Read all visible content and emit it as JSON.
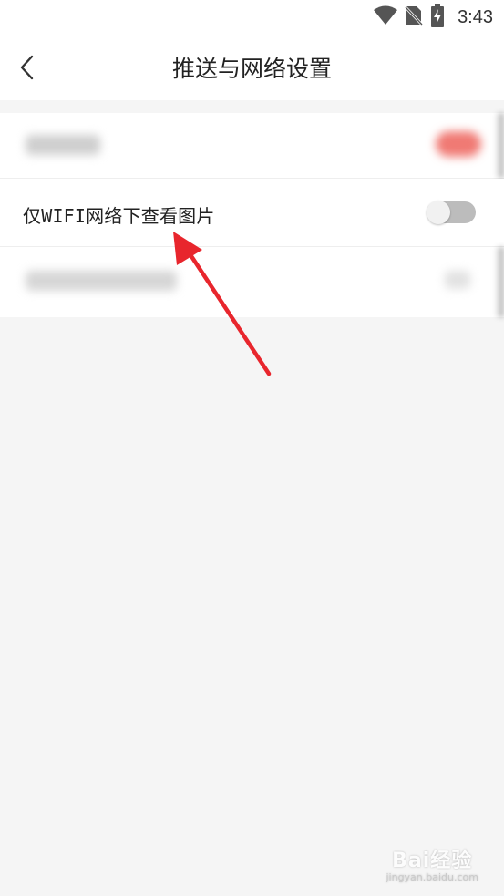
{
  "status_bar": {
    "time": "3:43",
    "icons": [
      "wifi-icon",
      "no-sim-icon",
      "battery-charging-icon"
    ]
  },
  "header": {
    "title": "推送与网络设置",
    "back_icon": "chevron-left-icon"
  },
  "settings": {
    "wifi_images_label": "仅WIFI网络下查看图片",
    "wifi_images_enabled": false
  },
  "watermark": {
    "main": "Bai经验",
    "sub": "jingyan.baidu.com"
  },
  "colors": {
    "annotation_arrow": "#e8262d",
    "toggle_off_track": "#bcbcbc",
    "toggle_knob": "#f1f1f1",
    "blurred_accent": "#f07a74"
  }
}
